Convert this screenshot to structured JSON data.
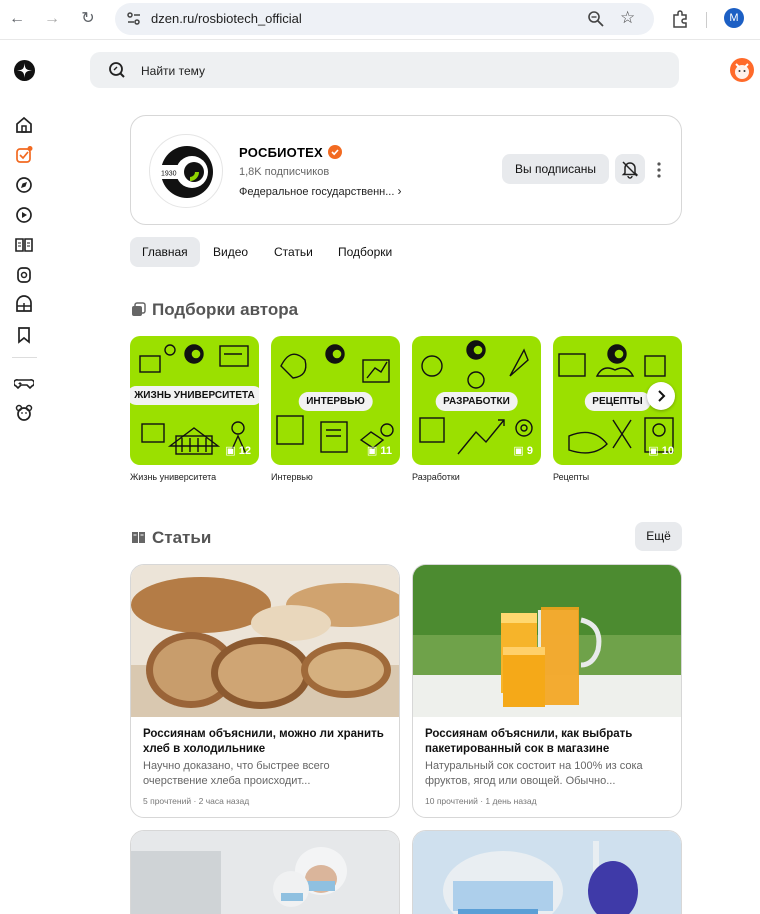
{
  "browser": {
    "url": "dzen.ru/rosbiotech_official",
    "profile_initial": "M"
  },
  "search": {
    "placeholder": "Найти тему"
  },
  "channel": {
    "name": "РОСБИОТЕХ",
    "subscribers": "1,8K подписчиков",
    "description": "Федеральное государственн...",
    "subscribe_label": "Вы подписаны",
    "logo_text": "1930"
  },
  "tabs": [
    {
      "label": "Главная",
      "active": true
    },
    {
      "label": "Видео",
      "active": false
    },
    {
      "label": "Статьи",
      "active": false
    },
    {
      "label": "Подборки",
      "active": false
    }
  ],
  "collections": {
    "title": "Подборки автора",
    "items": [
      {
        "badge": "ЖИЗНЬ УНИВЕРСИТЕТА",
        "count": "12",
        "label": "Жизнь университета"
      },
      {
        "badge": "ИНТЕРВЬЮ",
        "count": "11",
        "label": "Интервью"
      },
      {
        "badge": "РАЗРАБОТКИ",
        "count": "9",
        "label": "Разработки"
      },
      {
        "badge": "РЕЦЕПТЫ",
        "count": "10",
        "label": "Рецепты"
      }
    ]
  },
  "articles": {
    "title": "Статьи",
    "more_label": "Ещё",
    "items": [
      {
        "title": "Россиянам объяснили, можно ли хранить хлеб в холодильнике",
        "desc": "Научно доказано, что быстрее всего очерствение хлеба происходит...",
        "meta": "5 прочтений · 2 часа назад"
      },
      {
        "title": "Россиянам объяснили, как выбрать пакетированный сок в магазине",
        "desc": "Натуральный сок состоит на 100% из сока фруктов, ягод или овощей. Обычно...",
        "meta": "10 прочтений · 1 день назад"
      }
    ]
  },
  "colors": {
    "accent": "#f26a21",
    "collection_green": "#9be000",
    "pill_bg": "#e8eaed"
  }
}
